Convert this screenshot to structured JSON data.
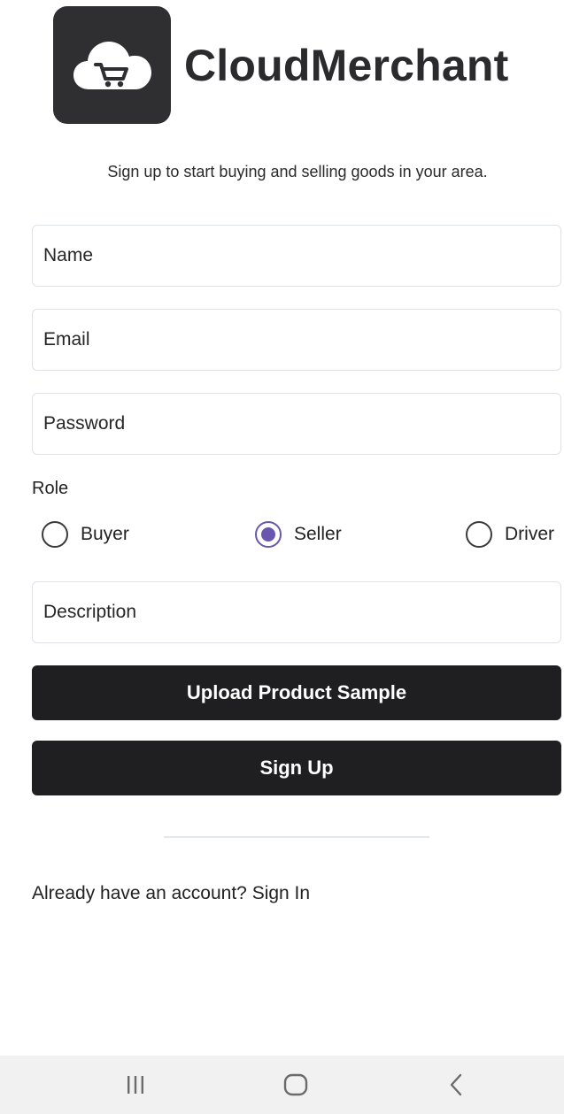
{
  "app": {
    "brand_name": "CloudMerchant",
    "tagline": "Sign up to start buying and selling goods in your area."
  },
  "form": {
    "name_placeholder": "Name",
    "email_placeholder": "Email",
    "password_placeholder": "Password",
    "role_label": "Role",
    "roles": [
      {
        "label": "Buyer",
        "selected": false
      },
      {
        "label": "Seller",
        "selected": true
      },
      {
        "label": "Driver",
        "selected": false
      }
    ],
    "description_placeholder": "Description",
    "upload_label": "Upload Product Sample",
    "signup_label": "Sign Up"
  },
  "footer": {
    "signin_prompt": "Already have an account?",
    "signin_link": "Sign In"
  },
  "icons": {
    "logo": "cloud-cart-icon",
    "nav_recents": "recents-icon",
    "nav_home": "home-icon",
    "nav_back": "back-icon"
  },
  "colors": {
    "primary_dark": "#1f1f22",
    "logo_bg": "#2f2f31",
    "radio_accent": "#6a56b0",
    "field_border": "#dfe2e8",
    "navbar_bg": "#f1f1f2"
  }
}
